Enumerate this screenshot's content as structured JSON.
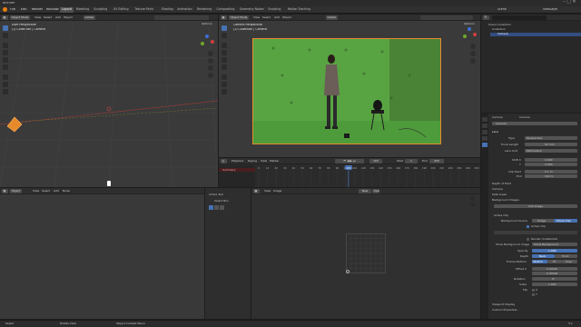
{
  "app": {
    "title": "Blender"
  },
  "menus": [
    "File",
    "Edit",
    "Render",
    "Window",
    "Help"
  ],
  "workspace_tabs": [
    "Layout",
    "Modeling",
    "Sculpting",
    "UV Editing",
    "Texture Paint",
    "Shading",
    "Animation",
    "Rendering",
    "Compositing",
    "Geometry Nodes",
    "Scripting",
    "Motion Tracking"
  ],
  "active_workspace": "Layout",
  "scene": "Scene",
  "view_layer": "ViewLayer",
  "left_viewport": {
    "mode": "Object Mode",
    "menus": [
      "View",
      "Select",
      "Add",
      "Object"
    ],
    "orientation": "Global",
    "options": "Options",
    "info_line1": "User Perspective",
    "info_line2": "(1) Collection | Camera",
    "mouse_label": "Middle"
  },
  "camera_viewport": {
    "mode": "Object Mode",
    "menus": [
      "View",
      "Select",
      "Add",
      "Object"
    ],
    "orientation": "Global",
    "options": "Options",
    "info_line1": "Camera Perspective",
    "info_line2": "(1) Collection | Camera"
  },
  "outliner": {
    "title": "Scene Collection",
    "items": [
      "Collection",
      "Camera"
    ]
  },
  "timeline": {
    "menus": [
      "Playback",
      "Keying",
      "View",
      "Marker"
    ],
    "track": "Summary",
    "start_label": "Start",
    "start": "1",
    "end_label": "End",
    "end": "250",
    "current_frame": "103",
    "ticks": [
      "0",
      "10",
      "20",
      "30",
      "40",
      "50",
      "60",
      "70",
      "80",
      "90",
      "100",
      "110",
      "120",
      "130",
      "140",
      "150",
      "160",
      "170",
      "180",
      "190",
      "200",
      "210",
      "220",
      "230",
      "240",
      "250"
    ]
  },
  "bottom_left": {
    "mode": "Object",
    "menus": [
      "View",
      "Select",
      "Add",
      "Node"
    ],
    "tool_panel_title": "Active Tool",
    "tool_name": "Select Box"
  },
  "image_editor": {
    "menus": [
      "View",
      "Image"
    ],
    "button": "New",
    "open": "Open"
  },
  "properties": {
    "object_name": "Camera",
    "data_name": "Camera",
    "sections": {
      "lens": "Lens",
      "type_label": "Type",
      "type_value": "Perspective",
      "focal_label": "Focal Length",
      "focal_value": "50 mm",
      "lens_unit_label": "Lens Unit",
      "lens_unit_value": "Millimeters",
      "shift_x_label": "Shift X",
      "shift_x_value": "0.000",
      "shift_y_label": "Y",
      "shift_y_value": "0.000",
      "clip_start_label": "Clip Start",
      "clip_start_value": "0.1 m",
      "clip_end_label": "End",
      "clip_end_value": "100 m",
      "dof": "Depth of Field",
      "camera": "Camera",
      "safe_areas": "Safe Areas",
      "bg_images": "Background Images",
      "add_image": "Add Image",
      "active_clip": "Active Clip",
      "bg_source_label": "Background Source",
      "bg_source_image": "Image",
      "bg_source_clip": "Movie Clip",
      "active_clip_check": "Active Clip",
      "render_undistorted": "Render Undistorted",
      "frame_method_label": "Show Background Image",
      "show_bg_label": "Show Background",
      "opacity_label": "Opacity",
      "opacity_value": "1.000",
      "depth_label": "Depth",
      "depth_back": "Back",
      "depth_front": "Front",
      "frame_label": "Frame Method",
      "frame_stretch": "Stretch",
      "frame_fit": "Fit",
      "frame_crop": "Crop",
      "offset_label": "Offset X",
      "offset_x": "0.00000",
      "offset_y": "0.00000",
      "rotation_label": "Rotation",
      "rotation_value": "0°",
      "scale_label": "Scale",
      "scale_value": "1.000",
      "flip_label": "Flip",
      "flip_x": "X",
      "flip_y": "Y",
      "viewport_display": "Viewport Display",
      "custom_properties": "Custom Properties"
    }
  },
  "statusbar": {
    "left": "Select",
    "middle": "Rotate View",
    "right": "Object Context Menu",
    "version": "3.x"
  },
  "colors": {
    "accent": "#4772b3",
    "greenscreen": "#4f9a3a",
    "playhead": "#4772b3",
    "selected_object": "#e58a2b"
  }
}
